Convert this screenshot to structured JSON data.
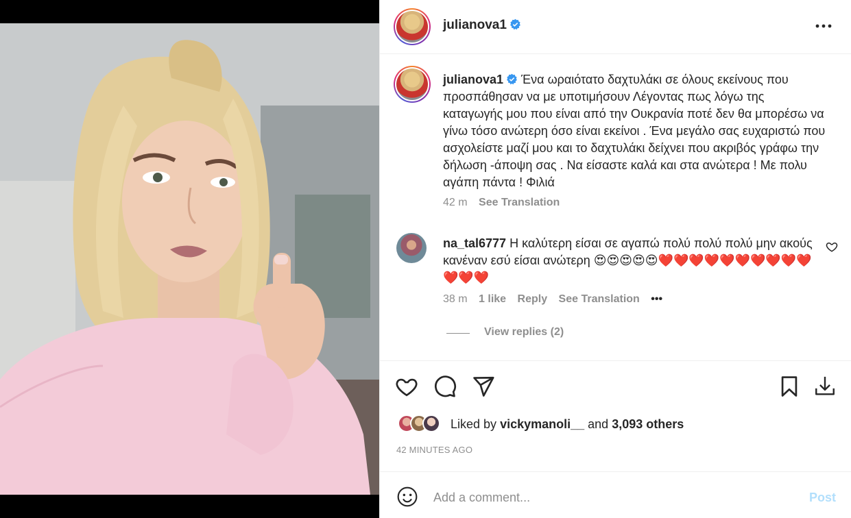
{
  "post": {
    "username": "julianova1",
    "verified": true,
    "more_icon": "more-horizontal-icon"
  },
  "caption": {
    "username": "julianova1",
    "text": "Ένα ωραιότατο δαχτυλάκι σε όλους εκείνους που προσπάθησαν να με υποτιμήσουν Λέγοντας πως λόγω της καταγωγής μου που είναι από την Ουκρανία ποτέ δεν θα μπορέσω να γίνω τόσο ανώτερη όσο είναι εκείνοι . Ένα μεγάλο σας ευχαριστώ που ασχολείστε μαζί μου και το δαχτυλάκι δείχνει που ακριβός γράφω την δήλωση -άποψη σας . Να είσαστε καλά και στα ανώτερα ! Με πολυ αγάπη πάντα ! Φιλιά",
    "time": "42 m",
    "see_translation": "See Translation"
  },
  "comment": {
    "username": "na_tal6777",
    "text": "Η καλύτερη είσαι σε αγαπώ πολύ πολύ πολύ μην ακούς κανέναν εσύ είσαι ανώτερη 😍😍😍😍😍❤️❤️❤️❤️❤️❤️❤️❤️❤️❤️❤️❤️❤️",
    "time": "38 m",
    "likes": "1 like",
    "reply": "Reply",
    "see_translation": "See Translation",
    "more": "•••",
    "view_replies": "View replies (2)"
  },
  "actions": {
    "liked_by_prefix": "Liked by",
    "liked_by_user": "vickymanoli__",
    "and_word": "and",
    "others": "3,093 others",
    "time_ago": "42 MINUTES AGO"
  },
  "comment_box": {
    "placeholder": "Add a comment...",
    "post_label": "Post"
  },
  "colors": {
    "verified_blue": "#3897f0",
    "post_disabled": "#b2dffc",
    "secondary_text": "#8e8e8e",
    "photo_sweater": "#f3cbd8"
  }
}
